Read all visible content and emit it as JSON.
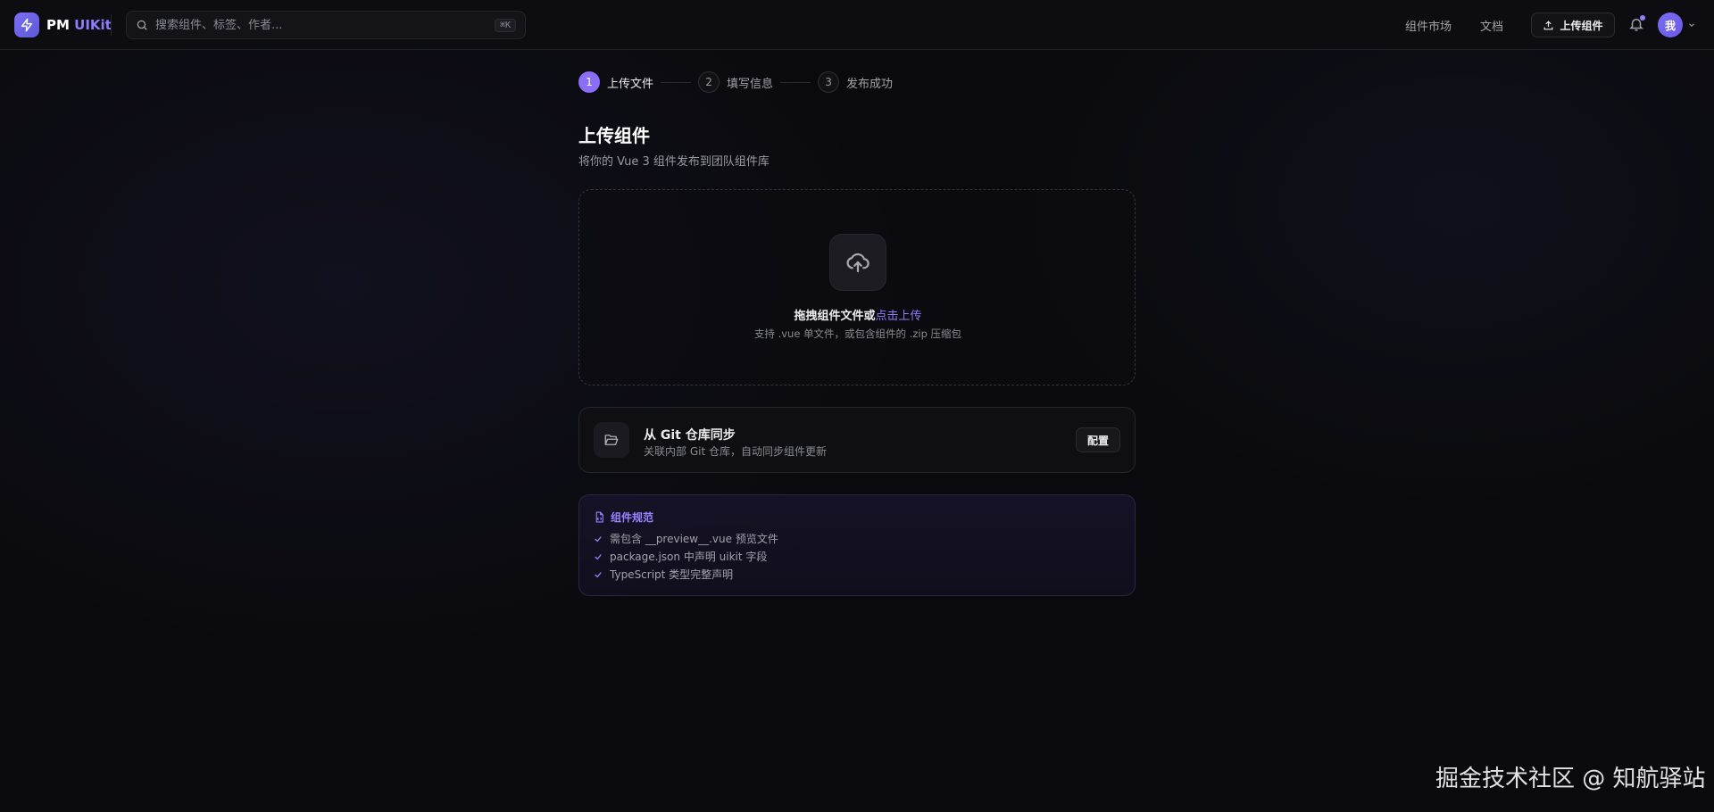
{
  "header": {
    "brand_pm": "PM",
    "brand_uikit": "UIKit",
    "search": {
      "placeholder": "搜索组件、标签、作者...",
      "shortcut": "⌘K"
    },
    "nav": [
      {
        "label": "组件市场"
      },
      {
        "label": "文档"
      }
    ],
    "upload_label": "上传组件",
    "avatar_label": "我"
  },
  "steps": [
    {
      "num": "1",
      "label": "上传文件",
      "active": true
    },
    {
      "num": "2",
      "label": "填写信息",
      "active": false
    },
    {
      "num": "3",
      "label": "发布成功",
      "active": false
    }
  ],
  "page": {
    "title": "上传组件",
    "subtitle": "将你的 Vue 3 组件发布到团队组件库"
  },
  "dropzone": {
    "title": "拖拽组件文件或",
    "link": "点击上传",
    "hint": "支持 .vue 单文件，或包含组件的 .zip 压缩包"
  },
  "git": {
    "title": "从 Git 仓库同步",
    "desc": "关联内部 Git 仓库，自动同步组件更新",
    "button": "配置"
  },
  "rules": {
    "title": "组件规范",
    "items": [
      "需包含 __preview__.vue 预览文件",
      "package.json 中声明 uikit 字段",
      "TypeScript 类型完整声明"
    ]
  },
  "watermark": "掘金技术社区 @ 知航驿站",
  "colors": {
    "accent": "#8b6ef8",
    "link": "#8d7cfb",
    "background": "#0a0a0e"
  }
}
